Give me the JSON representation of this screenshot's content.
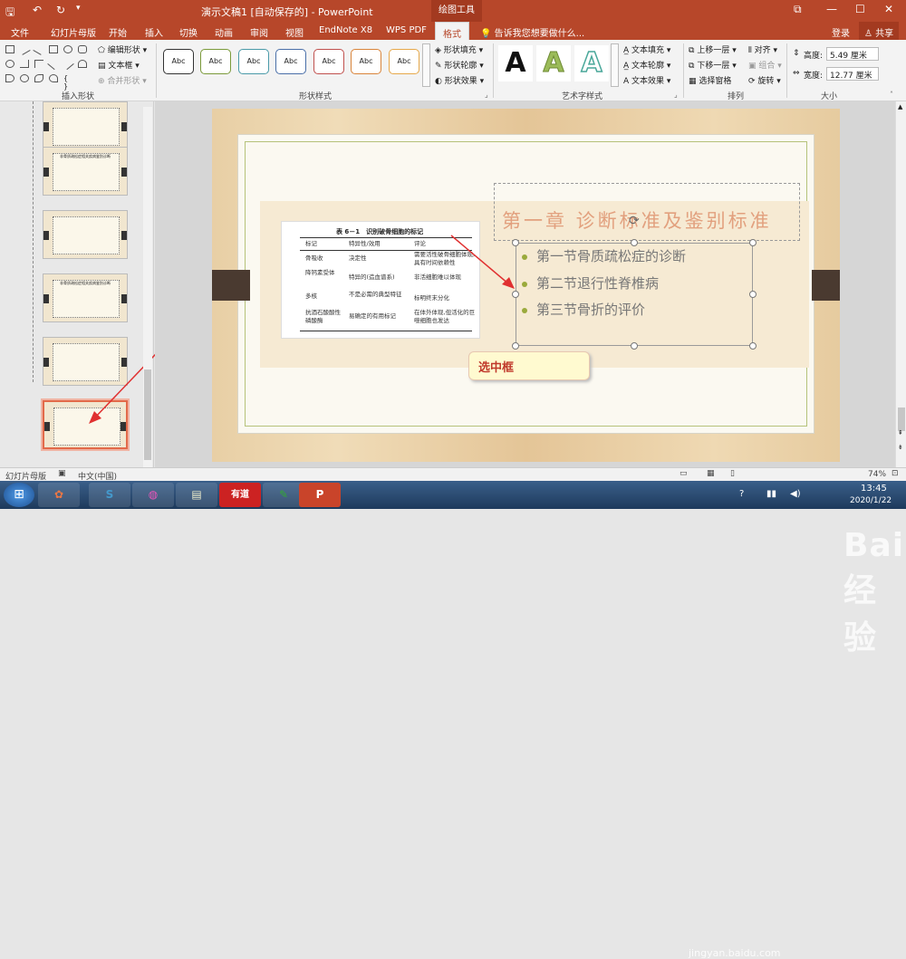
{
  "titlebar": {
    "quick_save": "🖫",
    "undo": "↶",
    "redo": "↻",
    "title": "演示文稿1 [自动保存的] - PowerPoint",
    "context_tab": "绘图工具",
    "restore": "⧉",
    "minimize": "—",
    "maximize": "☐",
    "close": "✕"
  },
  "tabs": {
    "items": [
      "文件",
      "幻灯片母版",
      "开始",
      "插入",
      "切换",
      "动画",
      "审阅",
      "视图",
      "EndNote X8",
      "WPS PDF"
    ],
    "active": "格式",
    "tell": "告诉我您想要做什么...",
    "login": "登录",
    "share": "共享"
  },
  "ribbon": {
    "insert_shapes": {
      "label": "插入形状",
      "edit_shape": "编辑形状",
      "text_box": "文本框",
      "merge_shapes": "合并形状"
    },
    "shape_styles": {
      "label": "形状样式",
      "sample": "Abc",
      "fill": "形状填充",
      "outline": "形状轮廓",
      "effects": "形状效果",
      "colors": [
        "#333333",
        "#7a9a3a",
        "#4a9aa8",
        "#4a6fa8",
        "#c0504d",
        "#d9843a",
        "#e6a84a"
      ]
    },
    "wordart": {
      "label": "艺术字样式",
      "letter": "A",
      "text_fill": "文本填充",
      "text_outline": "文本轮廓",
      "text_effects": "文本效果"
    },
    "arrange": {
      "label": "排列",
      "bring_forward": "上移一层",
      "send_backward": "下移一层",
      "selection_pane": "选择窗格",
      "align": "对齐",
      "group": "组合",
      "rotate": "旋转"
    },
    "size": {
      "label": "大小",
      "height_label": "高度:",
      "height_value": "5.49 厘米",
      "width_label": "宽度:",
      "width_value": "12.77 厘米"
    }
  },
  "thumbs": {
    "numbers": [
      "",
      "",
      "",
      "",
      "",
      ""
    ],
    "thumb_title": "非骨质疏松症相关疾病鉴别诊断"
  },
  "slide": {
    "table": {
      "title": "表 6－1　识别破骨细胞的标记",
      "headers": [
        "标记",
        "特异性/效用",
        "评论"
      ],
      "rows": [
        [
          "骨吸收",
          "决定性",
          "需要活性破骨细胞体现,具有时间依赖性"
        ],
        [
          "降钙素受体",
          "特异的(造血谱系)",
          "非活细胞难以体现"
        ],
        [
          "多核",
          "不是必需的典型特征",
          "标明终末分化"
        ],
        [
          "抗酒石酸酸性磷酸酶",
          "易确定的有用标记",
          "在体外体现,但活化的巨噬细胞也发达"
        ]
      ]
    },
    "title": "第一章 诊断标准及鉴别标准",
    "bullets": [
      "第一节骨质疏松症的诊断",
      "第二节退行性脊椎病",
      "第三节骨折的评价"
    ],
    "callout": "选中框"
  },
  "status": {
    "view": "幻灯片母版",
    "lang": "中文(中国)",
    "zoom": "74%"
  },
  "taskbar": {
    "apps": [
      "S",
      "◍",
      "▤",
      "有道",
      "✎",
      "P"
    ],
    "time": "13:45",
    "date": "2020/1/22"
  },
  "watermark": {
    "brand": "Bai经验",
    "url": "jingyan.baidu.com"
  }
}
